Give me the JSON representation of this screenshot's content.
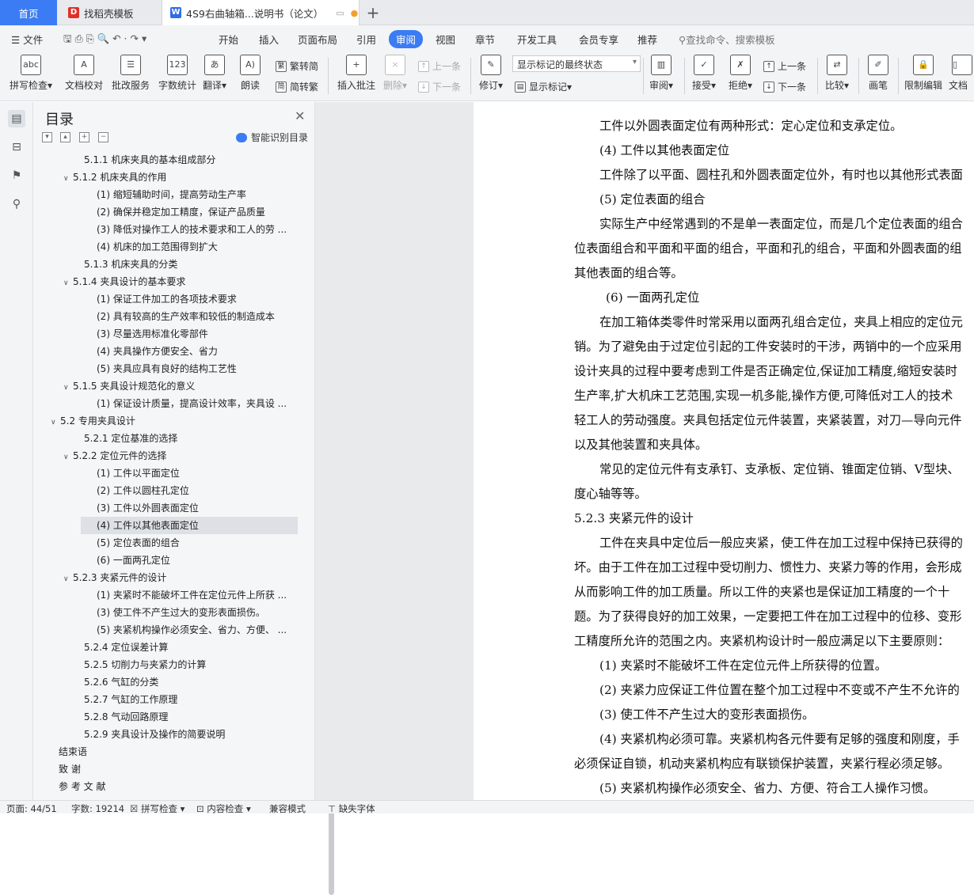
{
  "tabs": {
    "home": "首页",
    "t1": "找稻壳模板",
    "t2": "4S9右曲轴箱...说明书（论文）"
  },
  "menu": {
    "file": "文件",
    "items": [
      "开始",
      "插入",
      "页面布局",
      "引用",
      "审阅",
      "视图",
      "章节",
      "开发工具",
      "会员专享",
      "推荐"
    ],
    "active": "审阅",
    "search": "查找命令、搜索模板"
  },
  "ribbon": {
    "spell": "拼写检查",
    "doccheck": "文档校对",
    "batch": "批改服务",
    "wordcount": "字数统计",
    "translate": "翻译",
    "read": "朗读",
    "t2s": "繁转简",
    "s2t": "简转繁",
    "insert_comment": "插入批注",
    "delete": "删除",
    "prev": "上一条",
    "next": "下一条",
    "track": "修订",
    "markup_select": "显示标记的最终状态",
    "show_markup": "显示标记",
    "review": "审阅",
    "accept": "接受",
    "reject": "拒绝",
    "prev2": "上一条",
    "next2": "下一条",
    "compare": "比较",
    "pen": "画笔",
    "restrict": "限制编辑",
    "doc": "文档"
  },
  "toc": {
    "title": "目录",
    "smart": "智能识别目录",
    "items": [
      {
        "label": "5.1.1   机床夹具的基本组成部分",
        "indent": 2,
        "caret": ""
      },
      {
        "label": "5.1.2   机床夹具的作用",
        "indent": 1,
        "caret": "v"
      },
      {
        "label": "(1)  缩短辅助时间，提高劳动生产率",
        "indent": 3,
        "caret": ""
      },
      {
        "label": "(2)  确保并稳定加工精度，保证产品质量",
        "indent": 3,
        "caret": ""
      },
      {
        "label": "(3)  降低对操作工人的技术要求和工人的劳 ...",
        "indent": 3,
        "caret": ""
      },
      {
        "label": "(4)  机床的加工范围得到扩大",
        "indent": 3,
        "caret": ""
      },
      {
        "label": "5.1.3   机床夹具的分类",
        "indent": 2,
        "caret": ""
      },
      {
        "label": "5.1.4   夹具设计的基本要求",
        "indent": 1,
        "caret": "v"
      },
      {
        "label": "(1)  保证工件加工的各项技术要求",
        "indent": 3,
        "caret": ""
      },
      {
        "label": "(2)  具有较高的生产效率和较低的制造成本",
        "indent": 3,
        "caret": ""
      },
      {
        "label": "(3)  尽量选用标准化零部件",
        "indent": 3,
        "caret": ""
      },
      {
        "label": "(4)  夹具操作方便安全、省力",
        "indent": 3,
        "caret": ""
      },
      {
        "label": "(5)  夹具应具有良好的结构工艺性",
        "indent": 3,
        "caret": ""
      },
      {
        "label": "5.1.5   夹具设计规范化的意义",
        "indent": 1,
        "caret": "v"
      },
      {
        "label": "(1)  保证设计质量，提高设计效率，夹具设 ...",
        "indent": 3,
        "caret": ""
      },
      {
        "label": "5.2   专用夹具设计",
        "indent": 0,
        "caret": "v"
      },
      {
        "label": "5.2.1  定位基准的选择",
        "indent": 2,
        "caret": ""
      },
      {
        "label": "5.2.2   定位元件的选择",
        "indent": 1,
        "caret": "v"
      },
      {
        "label": "(1)  工件以平面定位",
        "indent": 3,
        "caret": ""
      },
      {
        "label": "(2)  工件以圆柱孔定位",
        "indent": 3,
        "caret": ""
      },
      {
        "label": "(3)  工件以外圆表面定位",
        "indent": 3,
        "caret": ""
      },
      {
        "label": "(4)  工件以其他表面定位",
        "indent": 3,
        "caret": "",
        "selected": true
      },
      {
        "label": "(5)  定位表面的组合",
        "indent": 3,
        "caret": ""
      },
      {
        "label": "(6)  一面两孔定位",
        "indent": 3,
        "caret": ""
      },
      {
        "label": "5.2.3   夹紧元件的设计",
        "indent": 1,
        "caret": "v"
      },
      {
        "label": "(1)  夹紧时不能破坏工件在定位元件上所获 ...",
        "indent": 3,
        "caret": ""
      },
      {
        "label": "(3)  使工件不产生过大的变形表面损伤。",
        "indent": 3,
        "caret": ""
      },
      {
        "label": "(5)  夹紧机构操作必须安全、省力、方便、 ...",
        "indent": 3,
        "caret": ""
      },
      {
        "label": "5.2.4   定位误差计算",
        "indent": 2,
        "caret": ""
      },
      {
        "label": "5.2.5   切削力与夹紧力的计算",
        "indent": 2,
        "caret": ""
      },
      {
        "label": "5.2.6   气缸的分类",
        "indent": 2,
        "caret": ""
      },
      {
        "label": "5.2.7   气缸的工作原理",
        "indent": 2,
        "caret": ""
      },
      {
        "label": "5.2.8   气动回路原理",
        "indent": 2,
        "caret": ""
      },
      {
        "label": "5.2.9   夹具设计及操作的简要说明",
        "indent": 2,
        "caret": ""
      },
      {
        "label": "结束语",
        "indent": -1,
        "caret": ""
      },
      {
        "label": "致  谢",
        "indent": -1,
        "caret": ""
      },
      {
        "label": "参 考 文 献",
        "indent": -1,
        "caret": ""
      }
    ]
  },
  "doc": {
    "lines": [
      {
        "text": "工件以外圆表面定位有两种形式：定心定位和支承定位。",
        "indent": 1
      },
      {
        "text": "(4)  工件以其他表面定位",
        "indent": 1
      },
      {
        "text": "工件除了以平面、圆柱孔和外圆表面定位外，有时也以其他形式表面",
        "indent": 1
      },
      {
        "text": "(5)  定位表面的组合",
        "indent": 1
      },
      {
        "text": "实际生产中经常遇到的不是单一表面定位，而是几个定位表面的组合",
        "indent": 1
      },
      {
        "text": "位表面组合和平面和平面的组合，平面和孔的组合，平面和外圆表面的组",
        "indent": 0
      },
      {
        "text": "其他表面的组合等。",
        "indent": 0
      },
      {
        "text": "(6)  一面两孔定位",
        "indent": 2
      },
      {
        "text": "在加工箱体类零件时常采用以面两孔组合定位，夹具上相应的定位元",
        "indent": 1
      },
      {
        "text": "销。为了避免由于过定位引起的工件安装时的干涉，两销中的一个应采用",
        "indent": 0
      },
      {
        "text": "设计夹具的过程中要考虑到工件是否正确定位,保证加工精度,缩短安装时",
        "indent": 0
      },
      {
        "text": "生产率,扩大机床工艺范围,实现一机多能,操作方便,可降低对工人的技术",
        "indent": 0
      },
      {
        "text": "轻工人的劳动强度。夹具包括定位元件装置，夹紧装置，对刀—导向元件",
        "indent": 0
      },
      {
        "text": "以及其他装置和夹具体。",
        "indent": 0
      },
      {
        "text": "常见的定位元件有支承钉、支承板、定位销、锥面定位销、V型块、",
        "indent": 1
      },
      {
        "text": "度心轴等等。",
        "indent": 0
      },
      {
        "text": "5.2.3    夹紧元件的设计",
        "indent": 0
      },
      {
        "text": "工件在夹具中定位后一般应夹紧，使工件在加工过程中保持已获得的",
        "indent": 1
      },
      {
        "text": "坏。由于工件在加工过程中受切削力、惯性力、夹紧力等的作用，会形成",
        "indent": 0
      },
      {
        "text": "从而影响工件的加工质量。所以工件的夹紧也是保证加工精度的一个十",
        "indent": 0
      },
      {
        "text": "题。为了获得良好的加工效果，一定要把工件在加工过程中的位移、变形",
        "indent": 0
      },
      {
        "text": "工精度所允许的范围之内。夹紧机构设计时一般应满足以下主要原则：",
        "indent": 0
      },
      {
        "text": "(1)  夹紧时不能破坏工件在定位元件上所获得的位置。",
        "indent": 1
      },
      {
        "text": "(2)  夹紧力应保证工件位置在整个加工过程中不变或不产生不允许的",
        "indent": 1
      },
      {
        "text": "(3)  使工件不产生过大的变形表面损伤。",
        "indent": 1
      },
      {
        "text": "(4)  夹紧机构必须可靠。夹紧机构各元件要有足够的强度和刚度，手",
        "indent": 1
      },
      {
        "text": "必须保证自锁，机动夹紧机构应有联锁保护装置，夹紧行程必须足够。",
        "indent": 0
      },
      {
        "text": "(5)  夹紧机构操作必须安全、省力、方便、符合工人操作习惯。",
        "indent": 1
      }
    ]
  },
  "status": {
    "page": "页面: 44/51",
    "words": "字数: 19214",
    "spell": "拼写检查",
    "content": "内容检查",
    "compat": "兼容模式",
    "font": "缺失字体"
  },
  "colors": {
    "accent": "#3b7cf4"
  }
}
